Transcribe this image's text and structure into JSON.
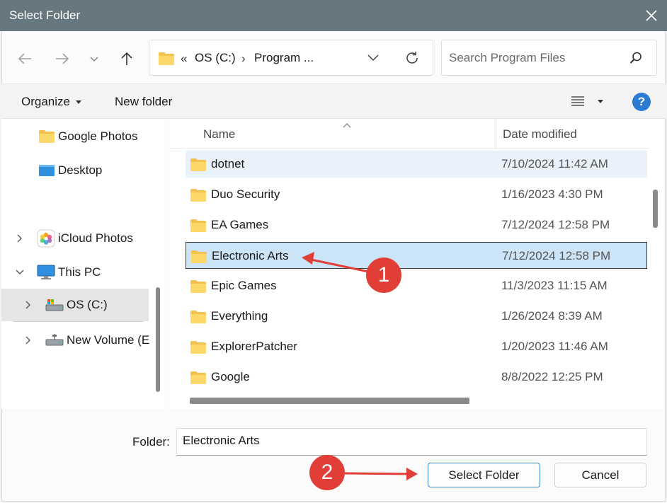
{
  "window": {
    "title": "Select Folder",
    "close_icon": "close-icon"
  },
  "nav": {
    "back_icon": "arrow-left-icon",
    "forward_icon": "arrow-right-icon",
    "recent_icon": "chevron-down-icon",
    "up_icon": "arrow-up-icon"
  },
  "address": {
    "overflow": "«",
    "crumbs": [
      "OS (C:)",
      "Program ..."
    ],
    "separator": "›"
  },
  "search": {
    "placeholder": "Search Program Files"
  },
  "toolbar": {
    "organize": "Organize",
    "new_folder": "New folder"
  },
  "sidebar": {
    "items": [
      {
        "label": "Google Photos",
        "icon": "folder-icon"
      },
      {
        "label": "Desktop",
        "icon": "desktop-icon"
      },
      {
        "label": "iCloud Photos",
        "icon": "icloud-photos-icon"
      },
      {
        "label": "This PC",
        "icon": "monitor-icon"
      },
      {
        "label": "OS (C:)",
        "icon": "drive-icon"
      },
      {
        "label": "New Volume (E",
        "icon": "network-drive-icon"
      }
    ]
  },
  "columns": {
    "name": "Name",
    "date": "Date modified"
  },
  "files": [
    {
      "name": "dotnet",
      "date": "7/10/2024 11:42 AM"
    },
    {
      "name": "Duo Security",
      "date": "1/16/2023 4:30 PM"
    },
    {
      "name": "EA Games",
      "date": "7/12/2024 12:58 PM"
    },
    {
      "name": "Electronic Arts",
      "date": "7/12/2024 12:58 PM"
    },
    {
      "name": "Epic Games",
      "date": "11/3/2023 11:15 AM"
    },
    {
      "name": "Everything",
      "date": "1/26/2024 8:39 AM"
    },
    {
      "name": "ExplorerPatcher",
      "date": "1/20/2023 11:46 AM"
    },
    {
      "name": "Google",
      "date": "8/8/2022 12:25 PM"
    }
  ],
  "footer": {
    "folder_label": "Folder:",
    "folder_value": "Electronic Arts",
    "select_button": "Select Folder",
    "cancel_button": "Cancel"
  },
  "annotations": {
    "step1": "1",
    "step2": "2",
    "color": "#e03e36"
  },
  "colors": {
    "titlebar": "#67777f",
    "selection": "#cce4f7",
    "accent": "#3a86c8"
  }
}
